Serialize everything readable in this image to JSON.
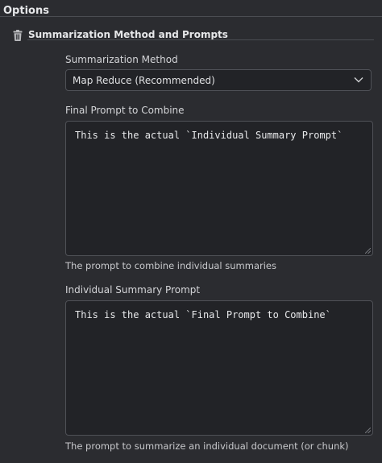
{
  "options": {
    "title": "Options"
  },
  "section": {
    "title": "Summarization Method and Prompts",
    "icon": "trash-icon"
  },
  "method": {
    "label": "Summarization Method",
    "selected": "Map Reduce (Recommended)"
  },
  "final_prompt": {
    "label": "Final Prompt to Combine",
    "value": "This is the actual `Individual Summary Prompt`",
    "help": "The prompt to combine individual summaries"
  },
  "individual_prompt": {
    "label": "Individual Summary Prompt",
    "value": "This is the actual `Final Prompt to Combine`",
    "help": "The prompt to summarize an individual document (or chunk)"
  }
}
